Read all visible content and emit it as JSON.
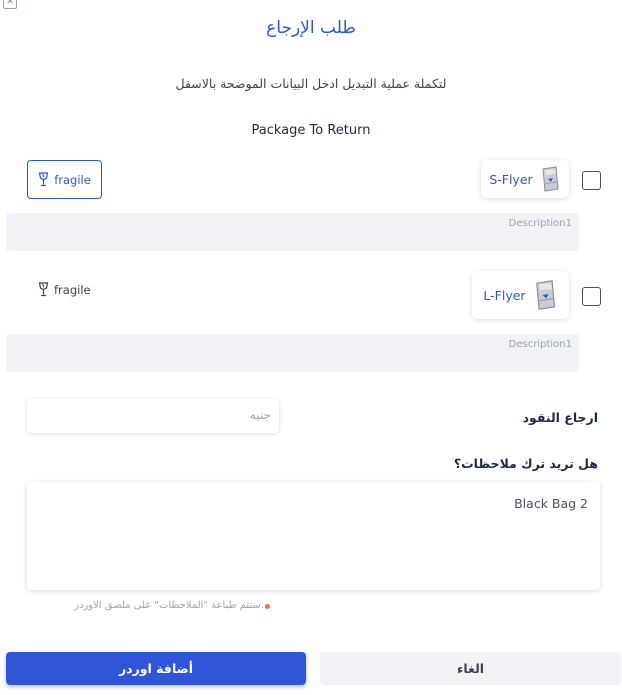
{
  "dialog": {
    "close_glyph": "✕",
    "title": "طلب الإرجاع",
    "subtitle": "لتكملة عملية التبديل ادخل البيانات الموضحة بالاسفل",
    "package_title": "Package To Return"
  },
  "packages": [
    {
      "name": "S-Flyer",
      "icon": "flyer-bag-icon",
      "fragile_label": "fragile",
      "fragile_active": true,
      "checked": false,
      "description_placeholder": "Description1"
    },
    {
      "name": "L-Flyer",
      "icon": "flyer-bag-icon",
      "fragile_label": "fragile",
      "fragile_active": false,
      "checked": false,
      "description_placeholder": "Description1"
    }
  ],
  "refund": {
    "label": "ارجاع النقود",
    "placeholder": "جنيه"
  },
  "notes": {
    "question": "هل تريد ترك ملاحظات؟",
    "value": "Black Bag 2",
    "hint": "ستتم طباعة \"الملاحظات\" على ملصق الاوردر."
  },
  "actions": {
    "submit_label": "أضافة اوردر",
    "cancel_label": "الغاء"
  },
  "colors": {
    "accent": "#2f56d8",
    "hint_dot": "#f07048",
    "field_bg": "#f1f3f7"
  }
}
